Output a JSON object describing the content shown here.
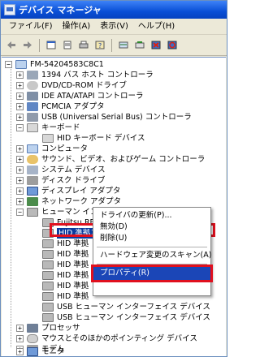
{
  "window": {
    "title": "デバイス マネージャ"
  },
  "menu": [
    "ファイル(F)",
    "操作(A)",
    "表示(V)",
    "ヘルプ(H)"
  ],
  "toolbar": {
    "icons": [
      "back-icon",
      "forward-icon",
      "view-icon",
      "properties-icon",
      "print-icon",
      "help-icon",
      "scan-icon",
      "update-driver-icon",
      "uninstall-icon",
      "disable-icon"
    ]
  },
  "tree": {
    "root": "FM-54204583C8C1",
    "nodes": [
      {
        "label": "1394 バス ホスト コントローラ",
        "exp": "+"
      },
      {
        "label": "DVD/CD-ROM ドライブ",
        "exp": "+"
      },
      {
        "label": "IDE ATA/ATAPI コントローラ",
        "exp": "+"
      },
      {
        "label": "PCMCIA アダプタ",
        "exp": "+"
      },
      {
        "label": "USB (Universal Serial Bus) コントローラ",
        "exp": "+"
      },
      {
        "label": "キーボード",
        "exp": "−"
      },
      {
        "label": "HID キーボード デバイス",
        "exp": ""
      },
      {
        "label": "コンピュータ",
        "exp": "+"
      },
      {
        "label": "サウンド、ビデオ、およびゲーム コントローラ",
        "exp": "+"
      },
      {
        "label": "システム デバイス",
        "exp": "+"
      },
      {
        "label": "ディスク ドライブ",
        "exp": "+"
      },
      {
        "label": "ディスプレイ アダプタ",
        "exp": "+"
      },
      {
        "label": "ネットワーク アダプタ",
        "exp": "+"
      },
      {
        "label": "ヒューマン インターフェイス デバイス",
        "exp": "−"
      },
      {
        "label": "Fujitsu RF Comfort Keyboard DV",
        "exp": ""
      },
      {
        "label": "HID 準拠コンシューマ制御デバイス",
        "exp": ""
      },
      {
        "label": "HID 準拠",
        "exp": ""
      },
      {
        "label": "HID 準拠",
        "exp": ""
      },
      {
        "label": "HID 準拠",
        "exp": ""
      },
      {
        "label": "HID 準拠",
        "exp": ""
      },
      {
        "label": "HID 準拠",
        "exp": ""
      },
      {
        "label": "HID 準拠",
        "exp": ""
      },
      {
        "label": "USB ヒューマン インターフェイス デバイス",
        "exp": ""
      },
      {
        "label": "USB ヒューマン インターフェイス デバイス",
        "exp": ""
      },
      {
        "label": "プロセッサ",
        "exp": "+"
      },
      {
        "label": "マウスとそのほかのポインティング デバイス",
        "exp": "+"
      },
      {
        "label": "モデム",
        "exp": "+"
      },
      {
        "label": "モニタ",
        "exp": "+"
      }
    ]
  },
  "context_menu": {
    "items": [
      "ドライバの更新(P)...",
      "無効(D)",
      "削除(U)",
      "ハードウェア変更のスキャン(A)",
      "プロパティ(R)"
    ],
    "selected": "プロパティ(R)"
  },
  "colors": {
    "selection": "#0a3a9e",
    "highlight_border": "#e0101e",
    "menu_selection": "#1b46b7"
  }
}
